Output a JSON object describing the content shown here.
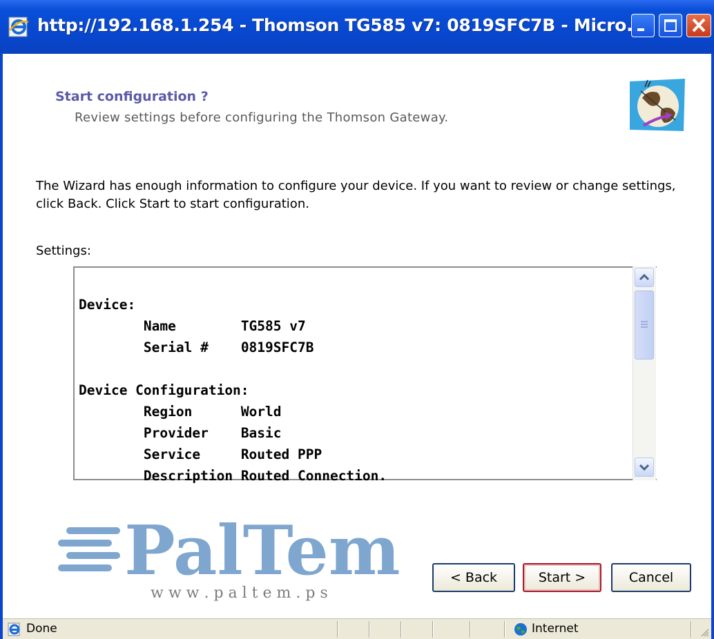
{
  "window": {
    "title": "http://192.168.1.254 - Thomson TG585 v7:  0819SFC7B - Micro..."
  },
  "wizard": {
    "heading": "Start configuration ?",
    "subheading": "Review settings before configuring the Thomson Gateway.",
    "intro": "The Wizard has enough information to configure your device. If you want to review or change settings, click Back. Click Start to start configuration.",
    "settings_label": "Settings:"
  },
  "settings": {
    "device_header": "Device:",
    "device_rows": [
      {
        "key": "Name",
        "value": "TG585 v7"
      },
      {
        "key": "Serial #",
        "value": "0819SFC7B"
      }
    ],
    "config_header": "Device Configuration:",
    "config_rows": [
      {
        "key": "Region",
        "value": "World"
      },
      {
        "key": "Provider",
        "value": "Basic"
      },
      {
        "key": "Service",
        "value": "Routed PPP"
      },
      {
        "key": "Description",
        "value": "Routed Connection."
      }
    ]
  },
  "buttons": {
    "back": "< Back",
    "start": "Start >",
    "cancel": "Cancel"
  },
  "watermark": {
    "brand": "PalTem",
    "url": "w w w . p a l t e m . p s"
  },
  "statusbar": {
    "status": "Done",
    "zone": "Internet"
  },
  "colors": {
    "titlebar": "#0a4fd8",
    "heading": "#5a5aa8",
    "start_border": "#a81a2a",
    "watermark": "#7fa6cf"
  }
}
